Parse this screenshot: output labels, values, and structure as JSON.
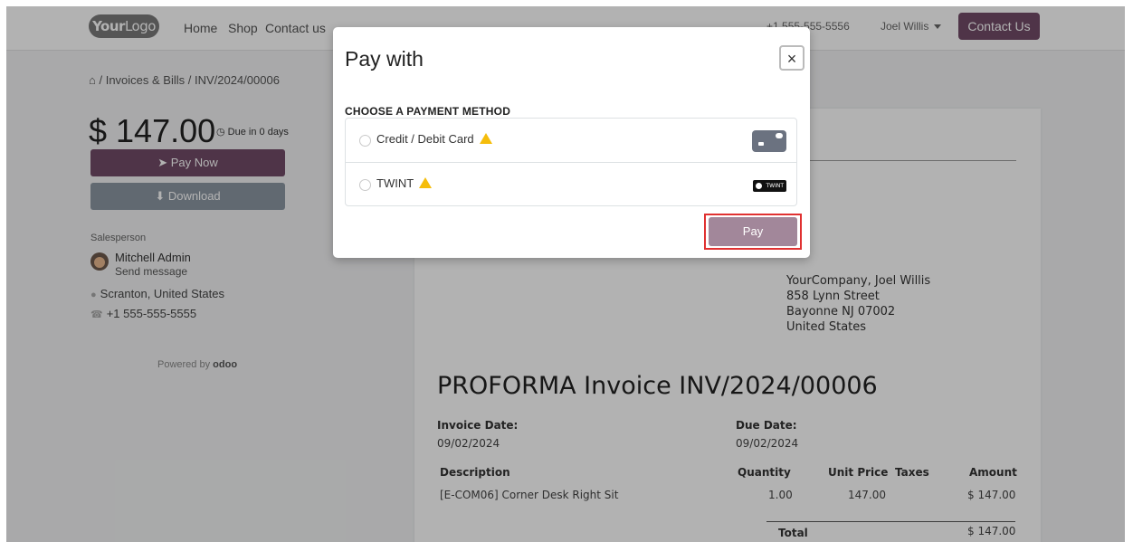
{
  "navbar": {
    "logo_bold": "Your",
    "logo_thin": "Logo",
    "links": [
      "Home",
      "Shop",
      "Contact us"
    ],
    "phone": "+1 555-555-5556",
    "user": "Joel Willis",
    "contact_button": "Contact Us"
  },
  "breadcrumb": {
    "home_icon": "home-icon",
    "text": "/ Invoices & Bills / INV/2024/00006"
  },
  "summary": {
    "amount": "$ 147.00",
    "due": "Due in 0 days",
    "pay_now": "Pay Now",
    "download": "Download"
  },
  "salesperson": {
    "label": "Salesperson",
    "name": "Mitchell Admin",
    "send_message": "Send message",
    "location": "Scranton, United States",
    "phone": "+1 555-555-5555"
  },
  "powered_by": {
    "prefix": "Powered by",
    "brand": "odoo"
  },
  "invoice": {
    "address": [
      "YourCompany, Joel Willis",
      "858 Lynn Street",
      "Bayonne NJ 07002",
      "United States"
    ],
    "title": "PROFORMA Invoice INV/2024/00006",
    "invoice_date_label": "Invoice Date:",
    "invoice_date": "09/02/2024",
    "due_date_label": "Due Date:",
    "due_date": "09/02/2024",
    "columns": [
      "Description",
      "Quantity",
      "Unit Price",
      "Taxes",
      "Amount"
    ],
    "line": {
      "description": "[E-COM06] Corner Desk Right Sit",
      "quantity": "1.00",
      "unit_price": "147.00",
      "amount": "$ 147.00"
    },
    "total_label": "Total",
    "total": "$ 147.00"
  },
  "modal": {
    "title": "Pay with",
    "close": "×",
    "section_title": "CHOOSE A PAYMENT METHOD",
    "methods": [
      {
        "label": "Credit / Debit Card",
        "icon": "credit-card-icon"
      },
      {
        "label": "TWINT",
        "icon": "twint-logo",
        "logo_text": "TWINT"
      }
    ],
    "pay_button": "Pay"
  },
  "colors": {
    "brand": "#714b67",
    "download": "#8b97a3",
    "warning": "#f5bd0b",
    "highlight": "#e03131"
  }
}
